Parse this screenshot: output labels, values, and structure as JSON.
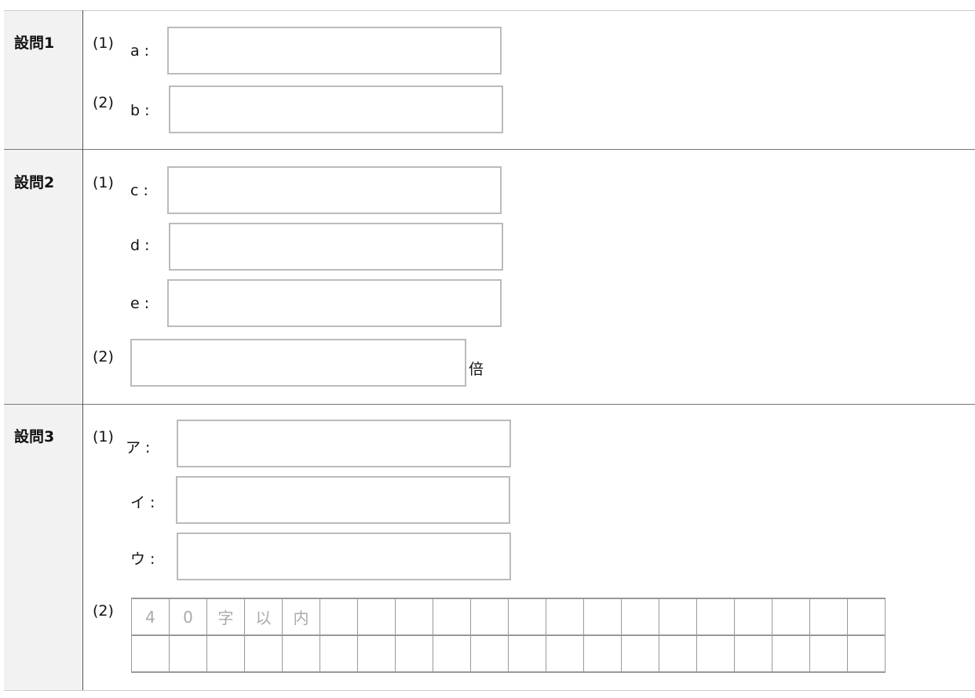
{
  "sections": [
    {
      "title": "設問1",
      "parts": [
        {
          "num": "(1)",
          "label": "a :"
        },
        {
          "num": "(2)",
          "label": "b :"
        }
      ]
    },
    {
      "title": "設問2",
      "parts": [
        {
          "num": "(1)",
          "label": "c :"
        },
        {
          "label": "d :"
        },
        {
          "label": "e :"
        },
        {
          "num": "(2)",
          "unit": "倍"
        }
      ]
    },
    {
      "title": "設問3",
      "parts": [
        {
          "num": "(1)",
          "label": "ア :"
        },
        {
          "label": "イ :"
        },
        {
          "label": "ウ :"
        },
        {
          "num": "(2)",
          "grid_hint": [
            "4",
            "0",
            "字",
            "以",
            "内"
          ],
          "grid_columns": 20,
          "grid_rows": 2
        }
      ]
    }
  ]
}
